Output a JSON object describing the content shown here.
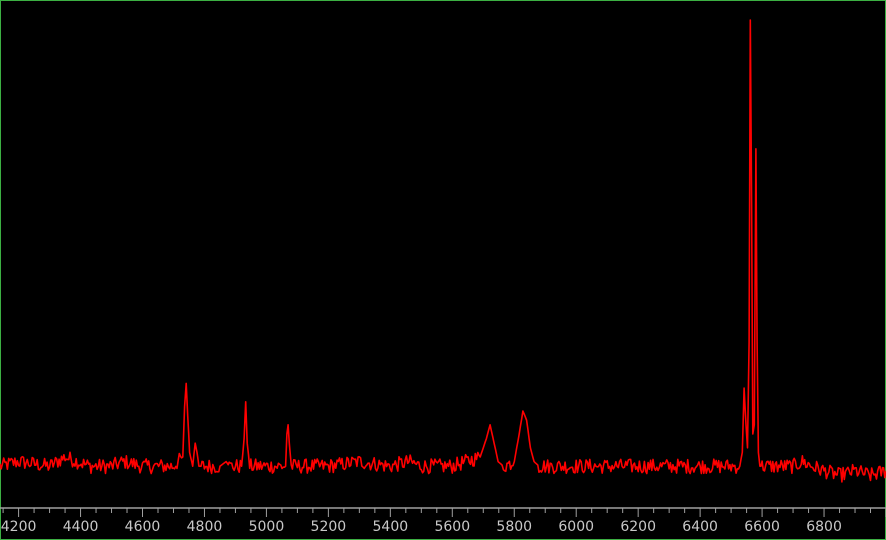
{
  "chart_data": {
    "type": "line",
    "title": "",
    "xlabel": "",
    "ylabel": "",
    "xlim": [
      4140,
      7000
    ],
    "ylim": [
      0,
      100
    ],
    "x_ticks": [
      4200,
      4400,
      4600,
      4800,
      5000,
      5200,
      5400,
      5600,
      5800,
      6000,
      6200,
      6400,
      6600,
      6800
    ],
    "tick_labels": [
      "4200",
      "4400",
      "4600",
      "4800",
      "5000",
      "5200",
      "5400",
      "5600",
      "5800",
      "6000",
      "6200",
      "6400",
      "6600",
      "6800"
    ],
    "grid": false,
    "legend": "none",
    "series": [
      {
        "color": "#ff0000",
        "x": [
          4140,
          4200,
          4300,
          4350,
          4430,
          4500,
          4540,
          4600,
          4700,
          4730,
          4736,
          4741,
          4746,
          4752,
          4762,
          4770,
          4776,
          4782,
          4792,
          4850,
          4870,
          4880,
          4920,
          4928,
          4933,
          4938,
          4946,
          5000,
          5062,
          5066,
          5070,
          5074,
          5080,
          5200,
          5300,
          5400,
          5460,
          5500,
          5600,
          5690,
          5710,
          5722,
          5735,
          5748,
          5765,
          5800,
          5816,
          5828,
          5840,
          5852,
          5864,
          5880,
          6000,
          6100,
          6200,
          6300,
          6400,
          6500,
          6528,
          6536,
          6542,
          6548,
          6553,
          6558,
          6562,
          6566,
          6570,
          6575,
          6580,
          6584,
          6588,
          6593,
          6600,
          6650,
          6700,
          6730,
          6760,
          6800,
          6850,
          6900,
          6950,
          7000
        ],
        "y": [
          3,
          4,
          3,
          5,
          3,
          3,
          4,
          3,
          3,
          5,
          16,
          21,
          14,
          6,
          3,
          8,
          6,
          3,
          3,
          3,
          4,
          3,
          3,
          9,
          17,
          8,
          3,
          3,
          3,
          10,
          12,
          8,
          3,
          3,
          4,
          3,
          4,
          3,
          3,
          5,
          9,
          12,
          8,
          4,
          3,
          4,
          10,
          15,
          13,
          7,
          4,
          3,
          3,
          3,
          3,
          3,
          3,
          3,
          3,
          6,
          20,
          12,
          7,
          30,
          100,
          60,
          10,
          12,
          72,
          30,
          6,
          3,
          3,
          3,
          3,
          4,
          3,
          2,
          1,
          2,
          1,
          2
        ]
      }
    ]
  }
}
